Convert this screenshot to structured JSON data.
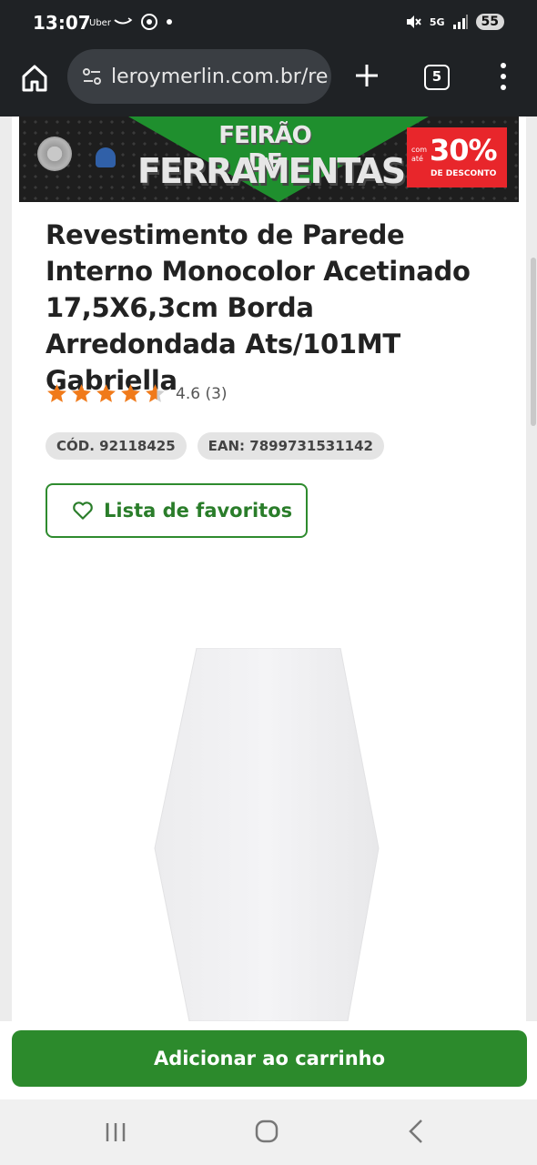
{
  "status_bar": {
    "time": "13:07",
    "uber_label": "Uber",
    "network": "5G",
    "battery": "55"
  },
  "browser": {
    "url": "leroymerlin.com.br/re",
    "tab_count": "5"
  },
  "banner": {
    "title_line1": "FEIRÃO DE",
    "title_line2": "FERRAMENTAS",
    "promo_prefix": "com até",
    "promo_value": "30%",
    "promo_suffix": "DE DESCONTO"
  },
  "product": {
    "title": "Revestimento de Parede Interno Monocolor Acetinado 17,5X6,3cm Borda Arredondada Ats/101MT Gabriella",
    "rating_value": "4.6",
    "rating_count": "(3)",
    "rating_score": 4.6,
    "codes": {
      "cod": "CÓD. 92118425",
      "ean": "EAN: 7899731531142"
    },
    "favorites_label": "Lista de favoritos"
  },
  "cart": {
    "button_label": "Adicionar ao carrinho"
  },
  "colors": {
    "brand_green": "#2c8a2c",
    "star_orange": "#f07a1a"
  }
}
